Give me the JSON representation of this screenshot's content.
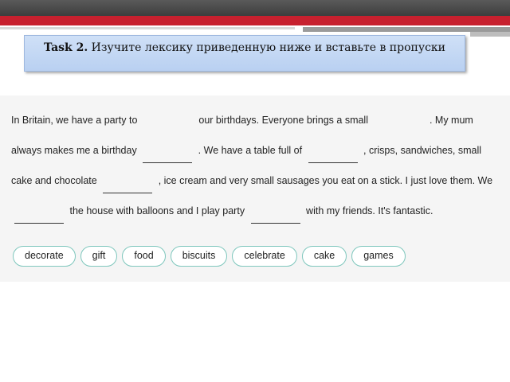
{
  "task": {
    "label": "Task 2.",
    "instruction": "Изучите лексику приведенную ниже и вставьте в пропуски"
  },
  "exercise": {
    "segments": [
      "In Britain, we have a party to",
      "our birthdays. Everyone brings a small",
      ". My mum always makes me a birthday",
      ". We have a table full of",
      ", crisps, sandwiches, small cake and chocolate",
      ", ice cream and very small sausages you eat on a stick. I just love them. We",
      "the house with balloons and I play party",
      "with my friends. It's fantastic."
    ]
  },
  "word_bank": [
    "decorate",
    "gift",
    "food",
    "biscuits",
    "celebrate",
    "cake",
    "games"
  ],
  "colors": {
    "header_dark": "#4a4a4a",
    "header_red": "#c7202e",
    "task_box": "#c4d8f4",
    "chip_border": "#7fc7bd"
  }
}
